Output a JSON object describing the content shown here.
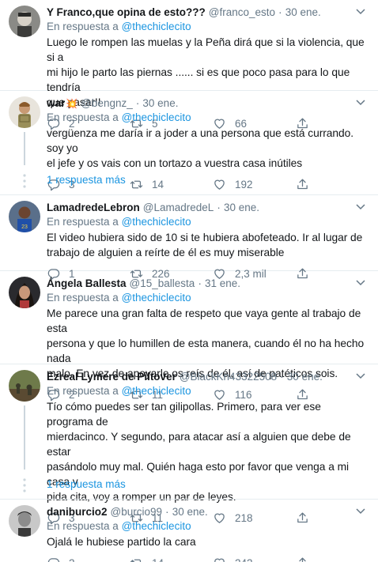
{
  "reply_prefix": "En respuesta a",
  "tweets": [
    {
      "display_name": "Y Franco,que opina de esto???",
      "handle": "@franco_esto",
      "time": "30 ene.",
      "reply_to": "@thechiclecito",
      "text": "Luego le rompen las muelas y la Peña dirá que si la violencia, que si a\nmi hijo le parto las piernas ...... si es que poco pasa para lo que tendría\nque pasar!!",
      "replies": "2",
      "retweets": "5",
      "likes": "66"
    },
    {
      "display_name": "war",
      "name_emoji": "💥",
      "handle": "@bengnz_",
      "time": "30 ene.",
      "reply_to": "@thechiclecito",
      "text": "vergüenza me daría ir a joder a una persona que está currando. soy yo\nel jefe y os vais con un tortazo a vuestra casa inútiles",
      "replies": "3",
      "retweets": "14",
      "likes": "192",
      "more_replies": "1 respuesta más"
    },
    {
      "display_name": "LamadredeLebron",
      "handle": "@LamadredeL",
      "time": "30 ene.",
      "reply_to": "@thechiclecito",
      "text": "El video hubiera sido de 10 si te hubiera abofeteado. Ir al lugar de\ntrabajo de alguien a reírte de él es muy miserable",
      "replies": "1",
      "retweets": "226",
      "likes": "2,3 mil"
    },
    {
      "display_name": "Ángela Ballesta",
      "handle": "@15_ballesta",
      "time": "31 ene.",
      "reply_to": "@thechiclecito",
      "text": "Me parece una gran falta de respeto que vaya gente al trabajo de esta\npersona y que lo humillen de esta manera, cuando él no ha hecho nada\nmalo. En vez de apoyarle os reís de él, así de patéticos sois.",
      "replies": "2",
      "retweets": "11",
      "likes": "116"
    },
    {
      "display_name": "Ezreal Lymere de Piltover",
      "handle": "@BlackKn43322508",
      "time": "30 ene.",
      "reply_to": "@thechiclecito",
      "text": "Tío cómo puedes ser tan gilipollas. Primero, para ver ese programa de\nmierdacinco. Y segundo, para atacar así a alguien que debe de estar\npasándolo muy mal. Quién haga esto por favor que venga a mi casa y\npida cita, voy a romper un par de leyes.",
      "replies": "3",
      "retweets": "11",
      "likes": "218",
      "more_replies": "1 respuesta más"
    },
    {
      "display_name": "daniburcio2",
      "handle": "@burcio99",
      "time": "30 ene.",
      "reply_to": "@thechiclecito",
      "text": "Ojalá le hubiese partido la cara",
      "replies": "2",
      "retweets": "14",
      "likes": "242"
    }
  ]
}
